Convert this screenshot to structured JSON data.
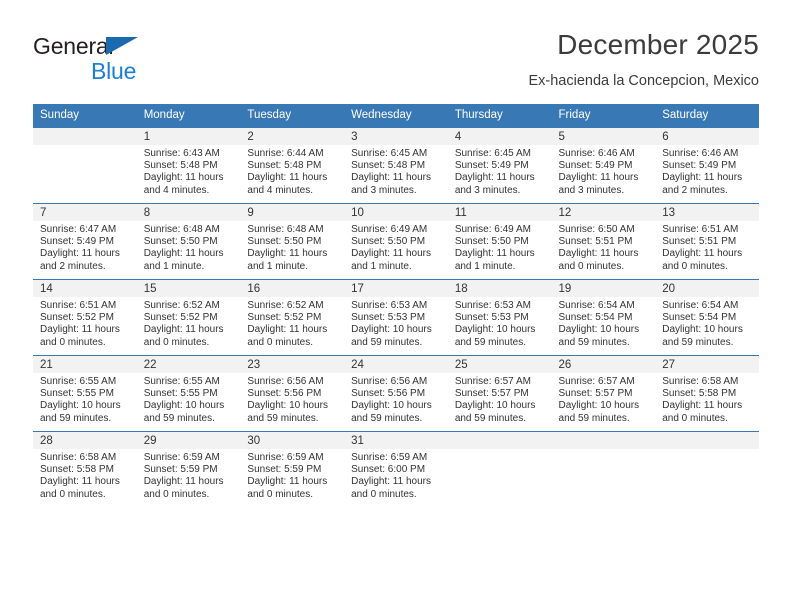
{
  "brand": {
    "line1": "General",
    "line2": "Blue",
    "triangle_color": "#1b69b0",
    "line2_color": "#1b7fd4"
  },
  "header": {
    "title": "December 2025",
    "subtitle": "Ex-hacienda la Concepcion, Mexico"
  },
  "theme": {
    "header_bg": "#3878b4",
    "daynum_bg": "#f2f2f2",
    "grid_line": "#3878b4"
  },
  "columns": [
    "Sunday",
    "Monday",
    "Tuesday",
    "Wednesday",
    "Thursday",
    "Friday",
    "Saturday"
  ],
  "weeks": [
    [
      {
        "day": "",
        "empty": true
      },
      {
        "day": "1",
        "sunrise": "Sunrise: 6:43 AM",
        "sunset": "Sunset: 5:48 PM",
        "daylight": "Daylight: 11 hours and 4 minutes."
      },
      {
        "day": "2",
        "sunrise": "Sunrise: 6:44 AM",
        "sunset": "Sunset: 5:48 PM",
        "daylight": "Daylight: 11 hours and 4 minutes."
      },
      {
        "day": "3",
        "sunrise": "Sunrise: 6:45 AM",
        "sunset": "Sunset: 5:48 PM",
        "daylight": "Daylight: 11 hours and 3 minutes."
      },
      {
        "day": "4",
        "sunrise": "Sunrise: 6:45 AM",
        "sunset": "Sunset: 5:49 PM",
        "daylight": "Daylight: 11 hours and 3 minutes."
      },
      {
        "day": "5",
        "sunrise": "Sunrise: 6:46 AM",
        "sunset": "Sunset: 5:49 PM",
        "daylight": "Daylight: 11 hours and 3 minutes."
      },
      {
        "day": "6",
        "sunrise": "Sunrise: 6:46 AM",
        "sunset": "Sunset: 5:49 PM",
        "daylight": "Daylight: 11 hours and 2 minutes."
      }
    ],
    [
      {
        "day": "7",
        "sunrise": "Sunrise: 6:47 AM",
        "sunset": "Sunset: 5:49 PM",
        "daylight": "Daylight: 11 hours and 2 minutes."
      },
      {
        "day": "8",
        "sunrise": "Sunrise: 6:48 AM",
        "sunset": "Sunset: 5:50 PM",
        "daylight": "Daylight: 11 hours and 1 minute."
      },
      {
        "day": "9",
        "sunrise": "Sunrise: 6:48 AM",
        "sunset": "Sunset: 5:50 PM",
        "daylight": "Daylight: 11 hours and 1 minute."
      },
      {
        "day": "10",
        "sunrise": "Sunrise: 6:49 AM",
        "sunset": "Sunset: 5:50 PM",
        "daylight": "Daylight: 11 hours and 1 minute."
      },
      {
        "day": "11",
        "sunrise": "Sunrise: 6:49 AM",
        "sunset": "Sunset: 5:50 PM",
        "daylight": "Daylight: 11 hours and 1 minute."
      },
      {
        "day": "12",
        "sunrise": "Sunrise: 6:50 AM",
        "sunset": "Sunset: 5:51 PM",
        "daylight": "Daylight: 11 hours and 0 minutes."
      },
      {
        "day": "13",
        "sunrise": "Sunrise: 6:51 AM",
        "sunset": "Sunset: 5:51 PM",
        "daylight": "Daylight: 11 hours and 0 minutes."
      }
    ],
    [
      {
        "day": "14",
        "sunrise": "Sunrise: 6:51 AM",
        "sunset": "Sunset: 5:52 PM",
        "daylight": "Daylight: 11 hours and 0 minutes."
      },
      {
        "day": "15",
        "sunrise": "Sunrise: 6:52 AM",
        "sunset": "Sunset: 5:52 PM",
        "daylight": "Daylight: 11 hours and 0 minutes."
      },
      {
        "day": "16",
        "sunrise": "Sunrise: 6:52 AM",
        "sunset": "Sunset: 5:52 PM",
        "daylight": "Daylight: 11 hours and 0 minutes."
      },
      {
        "day": "17",
        "sunrise": "Sunrise: 6:53 AM",
        "sunset": "Sunset: 5:53 PM",
        "daylight": "Daylight: 10 hours and 59 minutes."
      },
      {
        "day": "18",
        "sunrise": "Sunrise: 6:53 AM",
        "sunset": "Sunset: 5:53 PM",
        "daylight": "Daylight: 10 hours and 59 minutes."
      },
      {
        "day": "19",
        "sunrise": "Sunrise: 6:54 AM",
        "sunset": "Sunset: 5:54 PM",
        "daylight": "Daylight: 10 hours and 59 minutes."
      },
      {
        "day": "20",
        "sunrise": "Sunrise: 6:54 AM",
        "sunset": "Sunset: 5:54 PM",
        "daylight": "Daylight: 10 hours and 59 minutes."
      }
    ],
    [
      {
        "day": "21",
        "sunrise": "Sunrise: 6:55 AM",
        "sunset": "Sunset: 5:55 PM",
        "daylight": "Daylight: 10 hours and 59 minutes."
      },
      {
        "day": "22",
        "sunrise": "Sunrise: 6:55 AM",
        "sunset": "Sunset: 5:55 PM",
        "daylight": "Daylight: 10 hours and 59 minutes."
      },
      {
        "day": "23",
        "sunrise": "Sunrise: 6:56 AM",
        "sunset": "Sunset: 5:56 PM",
        "daylight": "Daylight: 10 hours and 59 minutes."
      },
      {
        "day": "24",
        "sunrise": "Sunrise: 6:56 AM",
        "sunset": "Sunset: 5:56 PM",
        "daylight": "Daylight: 10 hours and 59 minutes."
      },
      {
        "day": "25",
        "sunrise": "Sunrise: 6:57 AM",
        "sunset": "Sunset: 5:57 PM",
        "daylight": "Daylight: 10 hours and 59 minutes."
      },
      {
        "day": "26",
        "sunrise": "Sunrise: 6:57 AM",
        "sunset": "Sunset: 5:57 PM",
        "daylight": "Daylight: 10 hours and 59 minutes."
      },
      {
        "day": "27",
        "sunrise": "Sunrise: 6:58 AM",
        "sunset": "Sunset: 5:58 PM",
        "daylight": "Daylight: 11 hours and 0 minutes."
      }
    ],
    [
      {
        "day": "28",
        "sunrise": "Sunrise: 6:58 AM",
        "sunset": "Sunset: 5:58 PM",
        "daylight": "Daylight: 11 hours and 0 minutes."
      },
      {
        "day": "29",
        "sunrise": "Sunrise: 6:59 AM",
        "sunset": "Sunset: 5:59 PM",
        "daylight": "Daylight: 11 hours and 0 minutes."
      },
      {
        "day": "30",
        "sunrise": "Sunrise: 6:59 AM",
        "sunset": "Sunset: 5:59 PM",
        "daylight": "Daylight: 11 hours and 0 minutes."
      },
      {
        "day": "31",
        "sunrise": "Sunrise: 6:59 AM",
        "sunset": "Sunset: 6:00 PM",
        "daylight": "Daylight: 11 hours and 0 minutes."
      },
      {
        "day": "",
        "empty": true
      },
      {
        "day": "",
        "empty": true
      },
      {
        "day": "",
        "empty": true
      }
    ]
  ]
}
